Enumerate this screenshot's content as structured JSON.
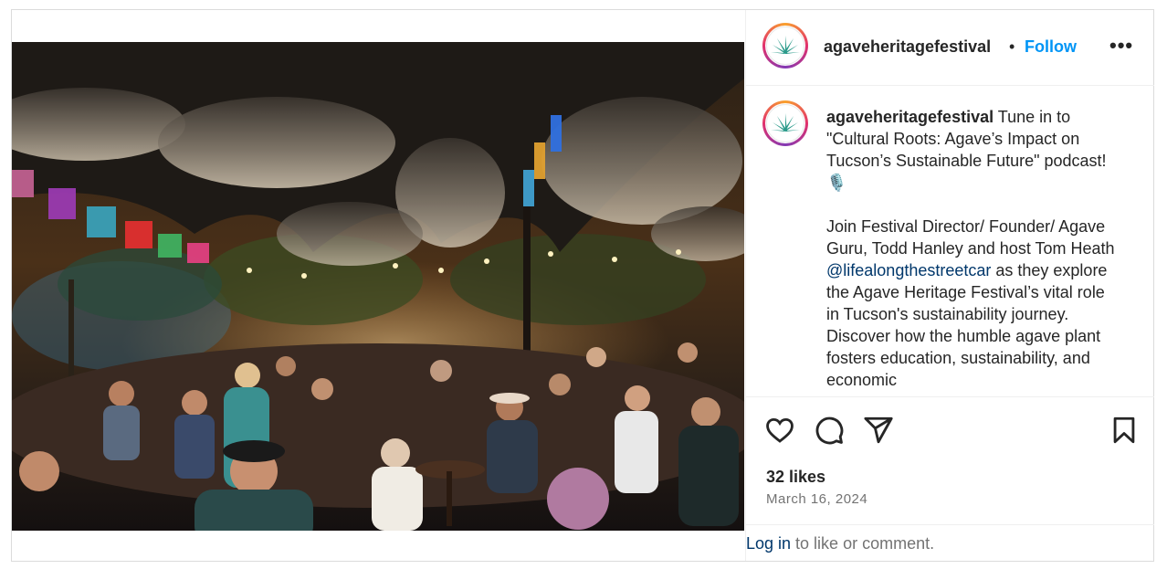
{
  "post": {
    "username": "agaveheritagefestival",
    "separator": "•",
    "follow_label": "Follow",
    "more_label": "•••",
    "image_icon": "festival-crowd-photo"
  },
  "caption": {
    "username": "agaveheritagefestival",
    "line1": " Tune in to \"Cultural Roots: Agave’s Impact on Tucson’s Sustainable Future\" podcast! 🎙️",
    "para2_a": "Join Festival Director/ Founder/ Agave Guru, Todd Hanley and host Tom Heath ",
    "mention": "@lifealongthestreetcar",
    "para2_b": " as they explore the Agave Heritage Festival’s vital role in Tucson's sustainability journey.",
    "para3": "Discover how the humble agave plant fosters education, sustainability, and economic"
  },
  "actions": {
    "like_icon": "heart-icon",
    "comment_icon": "comment-icon",
    "share_icon": "share-icon",
    "save_icon": "bookmark-icon",
    "likes": "32 likes",
    "date": "March 16, 2024"
  },
  "footer": {
    "login_link": "Log in",
    "login_rest": " to like or comment."
  }
}
